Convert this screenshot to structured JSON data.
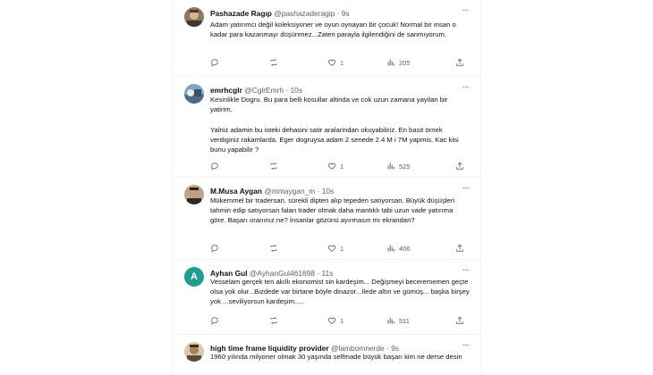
{
  "tweets": [
    {
      "name": "Pashazade Ragıp",
      "handle": "@pashazaderagip",
      "separator": "·",
      "time": "9s",
      "text": "Adam yatırımcı değil koleksiyoner ve oyun oynayan bir çocuk! Normal bir insan o kadar para kazanmayı düşünmez...Zaten parayla ilgilendiğini de sanmıyorum.",
      "likes": "1",
      "views": "205",
      "avatar": "portrait-photo"
    },
    {
      "name": "emrhcglr",
      "handle": "@CglrEmrh",
      "separator": "·",
      "time": "10s",
      "text": "Kesinlikle Dogru. Bu para belli kosullar altinda ve cok uzun zamana yayilan bir yatirim.\n\nYalniz adamin bu isteki dehasini satir aralarindan okuyabiliriz. En basit örnek  verdiginiz rakamlarda. Eger dogruysa adam 2 senede 2.4 M i 7M yapmis. Kac kisi bunu yapabilir ?",
      "likes": "1",
      "views": "525",
      "avatar": "landscape-photo"
    },
    {
      "name": "M.Musa Aygan",
      "handle": "@mmaygan_m",
      "separator": "·",
      "time": "10s",
      "text": "Mükemmel bir tradersan, sürekli dipten alıp tepeden satıyorsan. Büyük düşüşleri tahmin edip satıyorsan falan trader olmak daha mantıklı tabi uzun vade yatırıma göre. Başarı oranınız ne? İnsanlar gözünü ayırmasın mı ekrandan?",
      "likes": "1",
      "views": "406",
      "avatar": "portrait-photo"
    },
    {
      "name": "Ayhan Gul",
      "handle": "@AyhanGul461698",
      "separator": "·",
      "time": "11s",
      "text": "Vesselam gerçek ten akıllı ekonomist sin kardeşim... Değişmeyi becerememen geçte olsa yok olur...Bizdede var birtane böyle dinazor...İlede altın ve gümüş... başka birşey yok ...seviliyorsun kardeşim.....",
      "likes": "1",
      "views": "511",
      "avatar": "A"
    },
    {
      "name": "high time frame liquidity provider",
      "handle": "@lambomnerde",
      "separator": "·",
      "time": "9s",
      "text": "1960 yılında milyoner olmak 30 yaşında selfmade büyük başarı kim ne derse desin",
      "likes": "",
      "views": "",
      "avatar": "portrait-photo"
    }
  ],
  "icons": {
    "more": "more-options-icon",
    "reply": "reply-icon",
    "retweet": "retweet-icon",
    "like": "like-icon",
    "views": "views-icon",
    "share": "share-icon"
  },
  "colors": {
    "text": "#0f1419",
    "secondary": "#536471",
    "divider": "#eff3f4",
    "avatar_letter_bg": "#1d9e8f"
  }
}
